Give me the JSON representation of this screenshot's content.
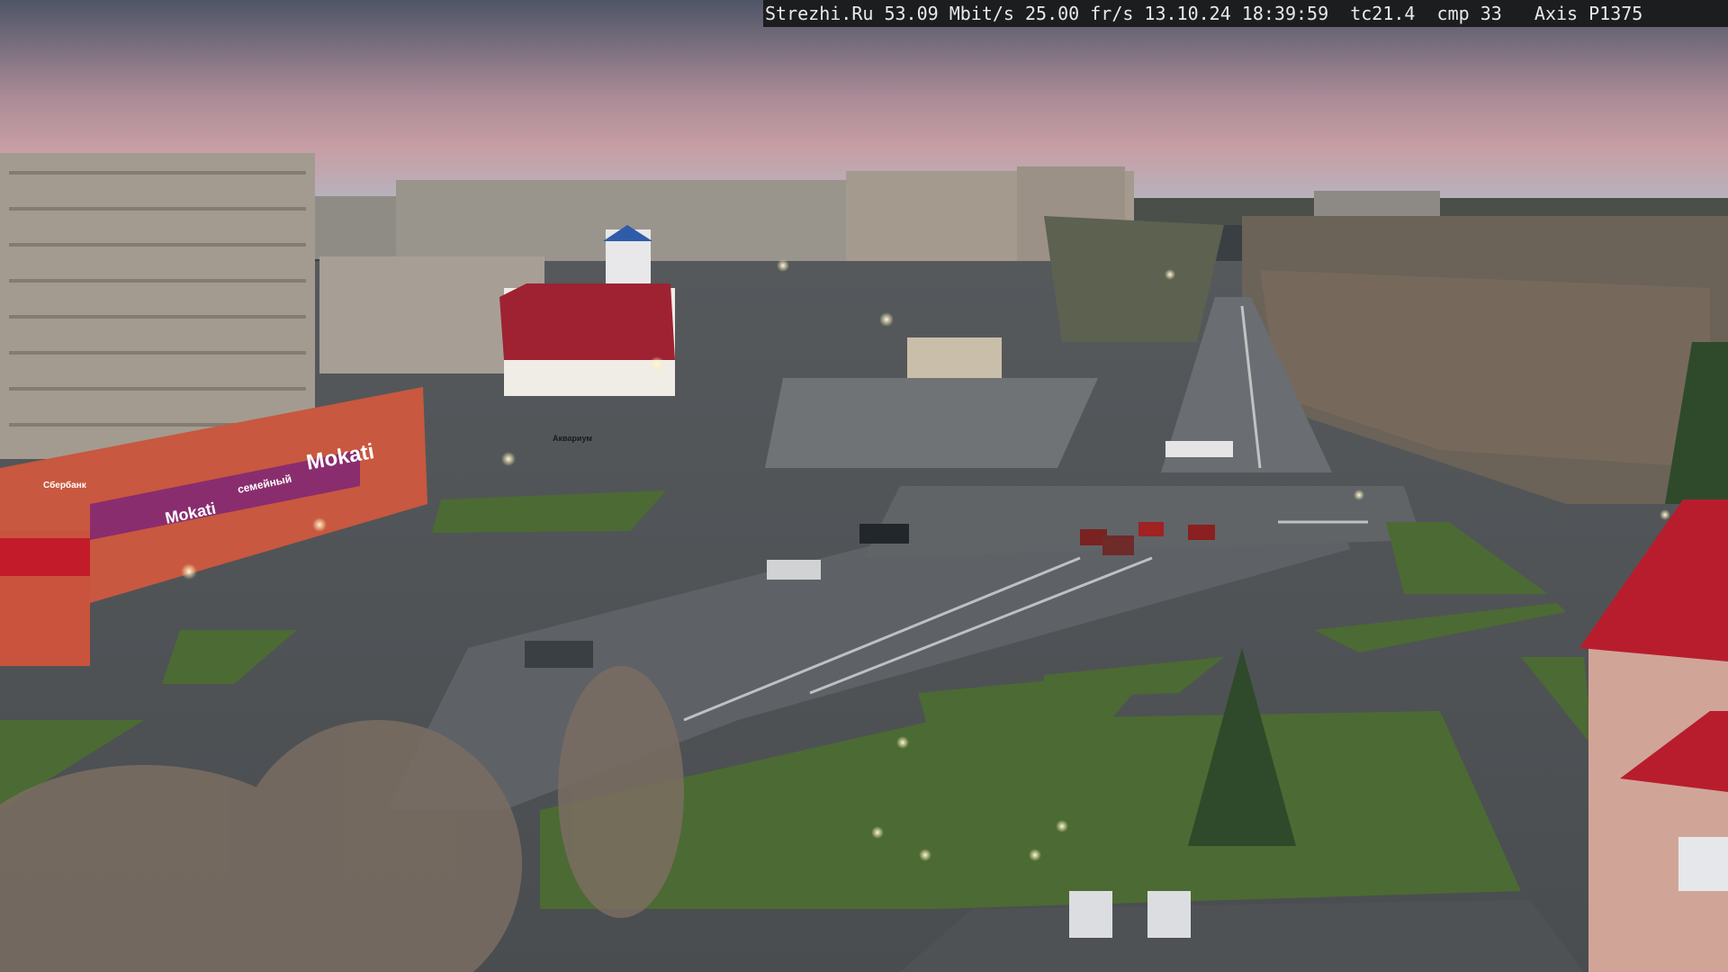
{
  "overlay": {
    "text": "Strezhi.Ru 53.09 Mbit/s 25.00 fr/s 13.10.24 18:39:59  tc21.4  cmp 33   Axis P1375"
  },
  "signs": {
    "mall_name_large": "Mokati",
    "mall_name_small": "Mokati",
    "mall_banner": "семейный",
    "bank_sign": "Сбербанк",
    "kiosk_sign": "Аквариум"
  },
  "colors": {
    "sky_top": "#5a6277",
    "sky_glow": "#c99aa0",
    "road": "#5b5f63",
    "grass": "#4a6a33",
    "brick": "#c9563f",
    "mall_purple": "#8a2d6e",
    "roof_red": "#b81d2e"
  }
}
